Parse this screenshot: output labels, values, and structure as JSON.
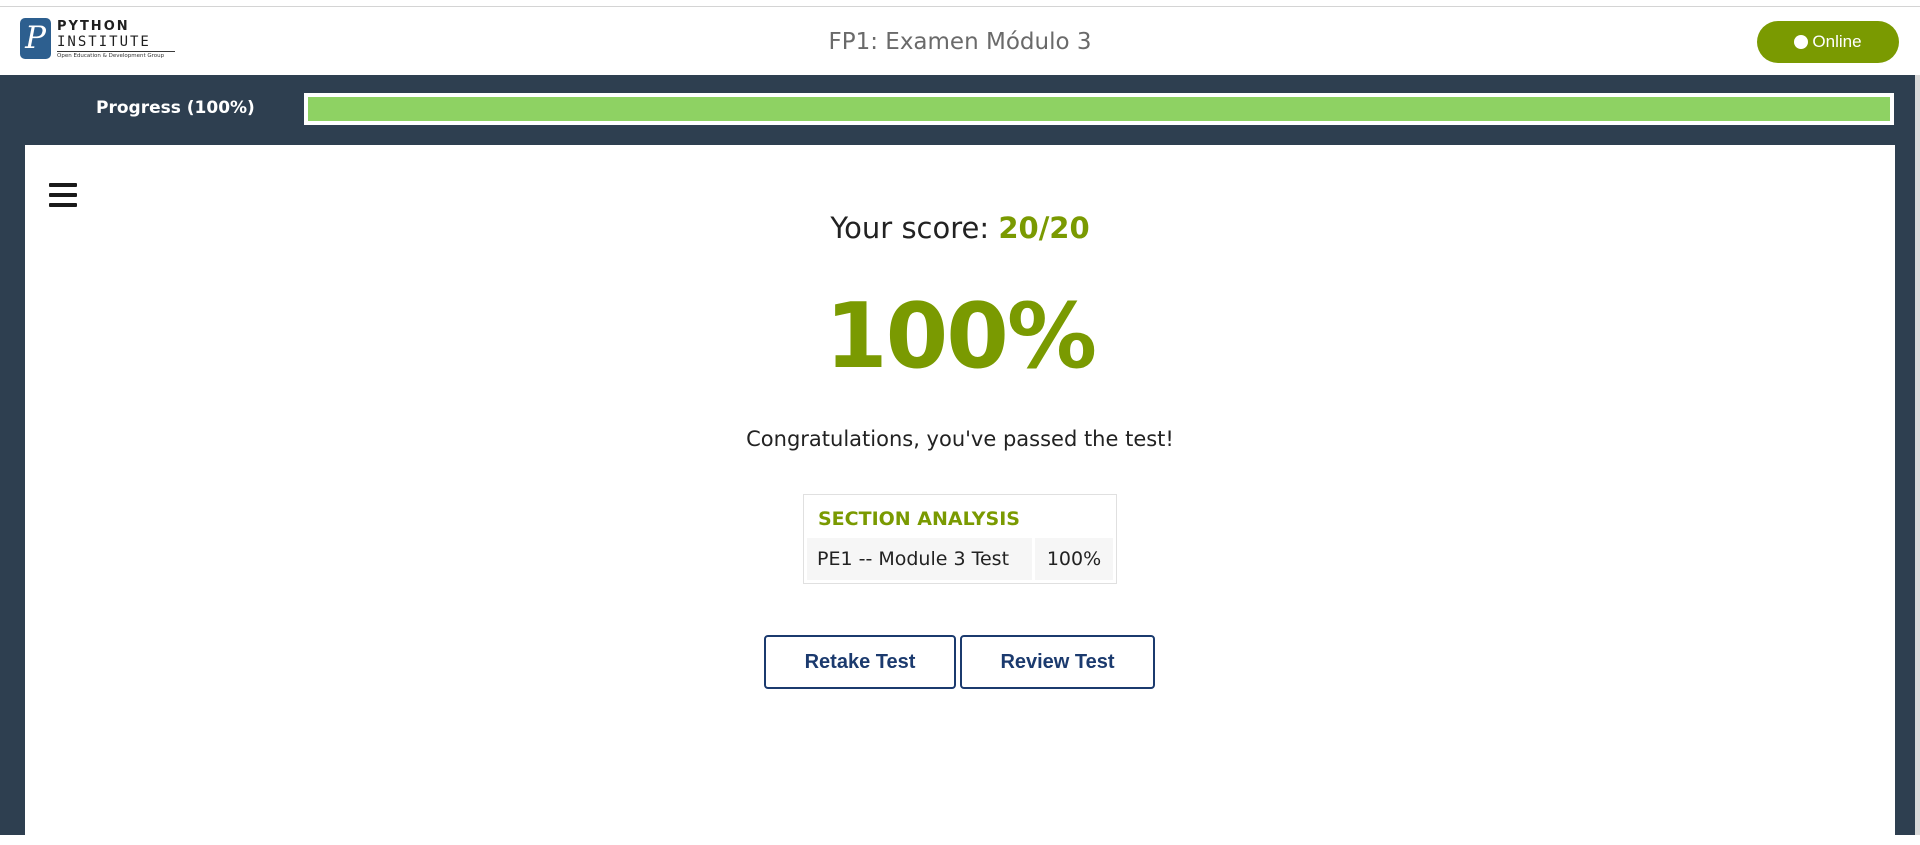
{
  "header": {
    "logo": {
      "mark": "P",
      "line1": "PYTHON",
      "line2": "INSTITUTE",
      "tagline": "Open Education & Development Group"
    },
    "title": "FP1: Examen Módulo 3",
    "status": {
      "label": "Online",
      "color": "#7a9a01"
    }
  },
  "progress": {
    "label": "Progress (100%)",
    "value_percent": 100,
    "fill_color": "#8ed263"
  },
  "result": {
    "score_prefix": "Your score: ",
    "score_value": "20/20",
    "percent": "100%",
    "message": "Congratulations, you've passed the test!",
    "accent_color": "#7a9a01"
  },
  "analysis": {
    "title": "SECTION ANALYSIS",
    "rows": [
      {
        "name": "PE1 -- Module 3 Test",
        "percent": "100%"
      }
    ]
  },
  "actions": {
    "retake_label": "Retake Test",
    "review_label": "Review Test"
  },
  "icons": {
    "menu": "hamburger-menu-icon",
    "status": "online-dot-icon"
  }
}
